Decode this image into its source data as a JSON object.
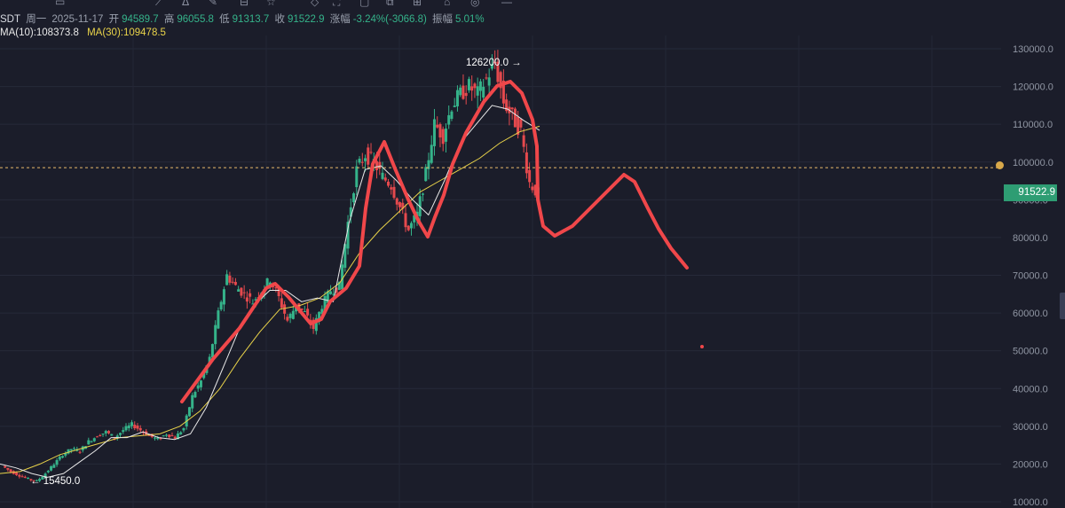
{
  "toolbar": {
    "icons": [
      "crop-icon",
      "pen-icon",
      "text-icon",
      "fib-icon",
      "measure-icon",
      "star-icon",
      "diamond-icon",
      "cross-icon",
      "square-icon",
      "camera-icon",
      "ruler-icon",
      "magnet-icon",
      "eye-icon",
      "minus-icon"
    ]
  },
  "info": {
    "symbol": "SDT",
    "weekday": "周一",
    "date": "2025-11-17",
    "open_label": "开",
    "open": "94589.7",
    "high_label": "高",
    "high": "96055.8",
    "low_label": "低",
    "low": "91313.7",
    "close_label": "收",
    "close": "91522.9",
    "change_label": "涨幅",
    "change": "-3.24%(-3066.8)",
    "amplitude_label": "振幅",
    "amplitude": "5.01%"
  },
  "ma": {
    "ma10": "MA(10):108373.8",
    "ma30": "MA(30):109478.5"
  },
  "price_tag": "91522.9",
  "annotations": {
    "high": "126200.0 →",
    "low": "← 15450.0"
  },
  "colors": {
    "background": "#1b1d2a",
    "up": "#35b38a",
    "down": "#e5494d",
    "ma10": "#e8e8e8",
    "ma30": "#e9d34a",
    "drawing": "#f0474a",
    "price_line": "#e8b86a"
  },
  "chart_data": {
    "type": "candlestick",
    "title": "",
    "xlabel": "",
    "ylabel": "",
    "ylim": [
      8000,
      134000
    ],
    "yticks": [
      "130000.0",
      "120000.0",
      "110000.0",
      "100000.0",
      "90000.0",
      "80000.0",
      "70000.0",
      "60000.0",
      "50000.0",
      "40000.0",
      "30000.0",
      "20000.0",
      "10000.0"
    ],
    "current_price_line": 98500,
    "price_series_approx": [
      19500,
      18000,
      17000,
      16000,
      15450,
      17500,
      20000,
      22500,
      24000,
      23500,
      26000,
      27500,
      28500,
      27000,
      29000,
      30500,
      29000,
      27500,
      26500,
      28000,
      27000,
      29500,
      38000,
      42000,
      48000,
      60000,
      70000,
      67000,
      65000,
      63000,
      66000,
      69000,
      64000,
      58000,
      62000,
      60000,
      56000,
      62000,
      66000,
      67000,
      84000,
      98000,
      102000,
      100000,
      96000,
      94000,
      88000,
      82000,
      86000,
      97000,
      110000,
      107000,
      115000,
      118000,
      120000,
      118000,
      122000,
      126200,
      116000,
      112000,
      108000,
      94500,
      91522.9
    ],
    "ma10_approx": [
      20000,
      19000,
      17500,
      16500,
      17500,
      20500,
      23500,
      27000,
      27000,
      28500,
      27000,
      26500,
      28000,
      35000,
      45000,
      55000,
      62000,
      66000,
      66000,
      63000,
      64000,
      63000,
      84000,
      98000,
      99000,
      95000,
      90000,
      86000,
      95000,
      105000,
      110000,
      115000,
      114000,
      111000,
      108373.8
    ],
    "ma30_approx": [
      17500,
      18000,
      20000,
      22500,
      24000,
      25500,
      27000,
      27500,
      28000,
      30000,
      34000,
      40000,
      48000,
      55000,
      61000,
      62000,
      64000,
      68000,
      76000,
      82000,
      87000,
      92000,
      95000,
      98000,
      101000,
      105000,
      108000,
      109478.5
    ],
    "drawing_path_note": ""
  }
}
